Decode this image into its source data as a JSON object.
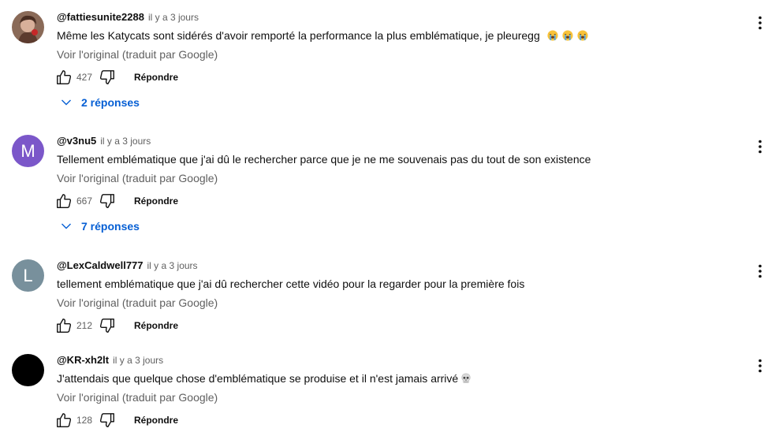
{
  "comments": [
    {
      "author": "@fattiesunite2288",
      "time": "il y a 3 jours",
      "text": "Même les Katycats sont sidérés d'avoir remporté la performance la plus emblématique, je pleuregg",
      "emoji": [
        "loudly-crying-face-icon",
        "loudly-crying-face-icon",
        "loudly-crying-face-icon"
      ],
      "translate_label": "Voir l'original (traduit par Google)",
      "likes": "427",
      "reply_label": "Répondre",
      "replies_label": "2 réponses",
      "avatar_letter": "",
      "avatar_color": "#7a5a4a"
    },
    {
      "author": "@v3nu5",
      "time": "il y a 3 jours",
      "text": "Tellement emblématique que j'ai dû le rechercher parce que je ne me souvenais pas du tout de son existence",
      "emoji": [],
      "translate_label": "Voir l'original (traduit par Google)",
      "likes": "667",
      "reply_label": "Répondre",
      "replies_label": "7 réponses",
      "avatar_letter": "M",
      "avatar_color": "#7b57c9"
    },
    {
      "author": "@LexCaldwell777",
      "time": "il y a 3 jours",
      "text": "tellement emblématique que j'ai dû rechercher cette vidéo pour la regarder pour la première fois",
      "emoji": [],
      "translate_label": "Voir l'original (traduit par Google)",
      "likes": "212",
      "reply_label": "Répondre",
      "replies_label": "",
      "avatar_letter": "L",
      "avatar_color": "#78909c"
    },
    {
      "author": "@KR-xh2lt",
      "time": "il y a 3 jours",
      "text": "J'attendais que quelque chose d'emblématique se produise et il n'est jamais arrivé",
      "emoji": [
        "skull-icon"
      ],
      "translate_label": "Voir l'original (traduit par Google)",
      "likes": "128",
      "reply_label": "Répondre",
      "replies_label": "",
      "avatar_letter": "",
      "avatar_color": "#000000"
    }
  ]
}
